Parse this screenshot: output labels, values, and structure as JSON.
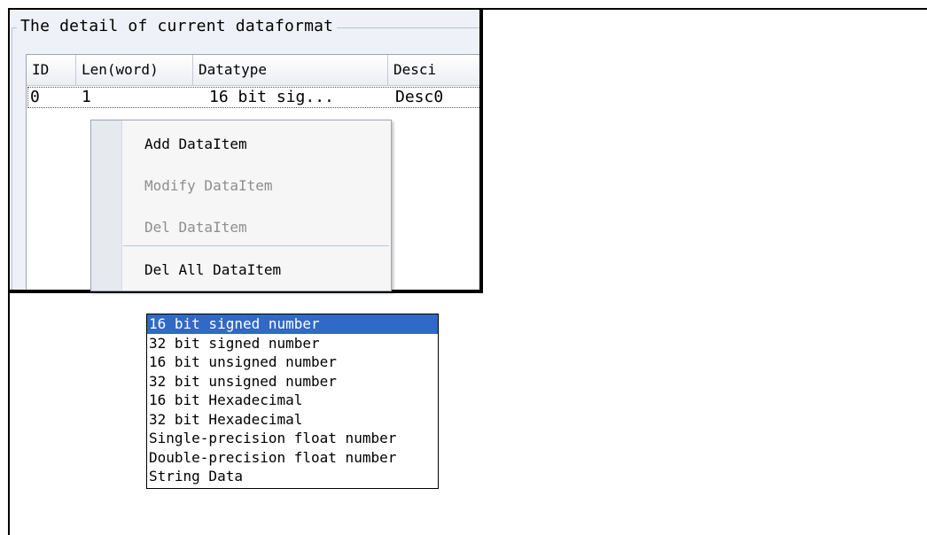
{
  "group": {
    "title": "The detail of current dataformat"
  },
  "listview": {
    "columns": [
      "ID",
      "Len(word)",
      "Datatype",
      "Desci"
    ],
    "rows": [
      {
        "id": "0",
        "len": "1",
        "datatype": "16 bit sig...",
        "desc": "Desc0"
      }
    ]
  },
  "context_menu": {
    "items": [
      {
        "label": "Add DataItem",
        "enabled": true
      },
      {
        "label": "Modify DataItem",
        "enabled": false
      },
      {
        "label": "Del DataItem",
        "enabled": false
      },
      {
        "label": "Del All DataItem",
        "enabled": true
      }
    ]
  },
  "datatype_dropdown": {
    "selected_index": 0,
    "options": [
      "16 bit signed number",
      "32 bit signed number",
      "16 bit unsigned number",
      "32 bit unsigned number",
      "16 bit Hexadecimal",
      "32 bit Hexadecimal",
      "Single-precision float number",
      "Double-precision float number",
      "String Data"
    ]
  },
  "colors": {
    "selection": "#3169c6",
    "panel_bg": "#eef1f7",
    "disabled_text": "#8e8e8e"
  }
}
